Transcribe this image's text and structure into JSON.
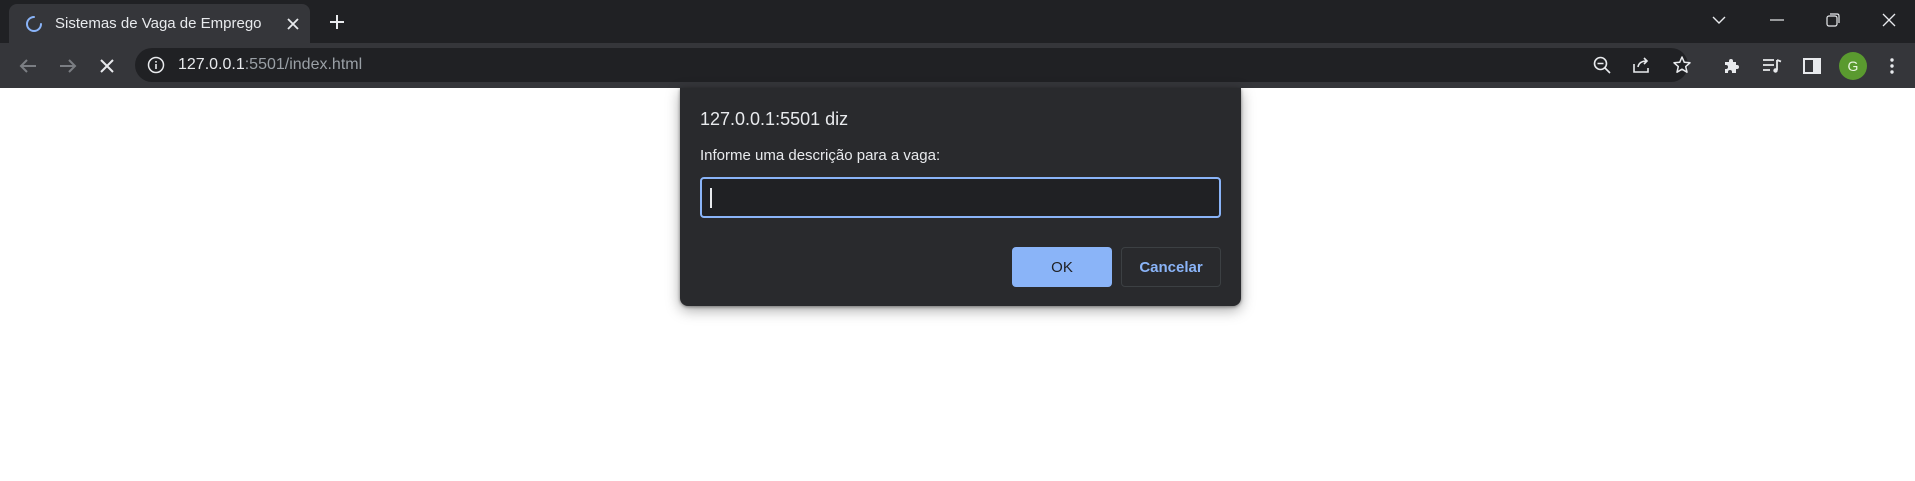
{
  "browser": {
    "tab": {
      "title": "Sistemas de Vaga de Emprego",
      "icon": "loading-spinner-icon"
    },
    "omnibox": {
      "host": "127.0.0.1",
      "path": ":5501/index.html"
    },
    "avatar_letter": "G"
  },
  "dialog": {
    "title": "127.0.0.1:5501 diz",
    "message": "Informe uma descrição para a vaga:",
    "input_value": "",
    "ok_label": "OK",
    "cancel_label": "Cancelar"
  },
  "colors": {
    "titlebar": "#202124",
    "toolbar": "#35363a",
    "dialog_bg": "#292a2d",
    "accent": "#8ab4f8",
    "avatar": "#5a9a2f"
  }
}
